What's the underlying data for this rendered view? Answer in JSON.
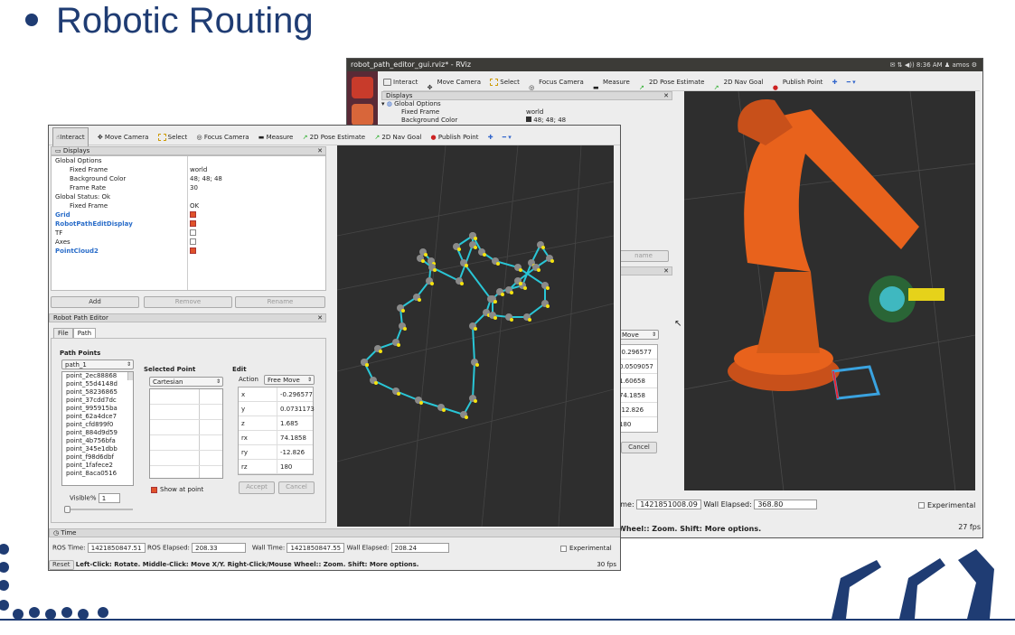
{
  "slide": {
    "title": "Robotic Routing"
  },
  "back_window": {
    "title": "robot_path_editor_gui.rviz* - RViz",
    "clock": "8:36 AM",
    "user": "amos",
    "toolbar": [
      "Interact",
      "Move Camera",
      "Select",
      "Focus Camera",
      "Measure",
      "2D Pose Estimate",
      "2D Nav Goal",
      "Publish Point"
    ],
    "displays_title": "Displays",
    "tree": [
      {
        "k": "Global Options",
        "v": ""
      },
      {
        "k": "Fixed Frame",
        "v": "world"
      },
      {
        "k": "Background Color",
        "v": "48; 48; 48"
      }
    ],
    "rename_partial": "name",
    "move_partial": "Move",
    "values": [
      "-0.296577",
      "0.0509057",
      "1.60658",
      "74.1858",
      "-12.826",
      "180"
    ],
    "cancel": "Cancel",
    "time_partial": "ime:",
    "ros_time": "1421851008.09",
    "wall_elapsed_label": "Wall Elapsed:",
    "wall_elapsed": "368.80",
    "experimental": "Experimental",
    "status": "Wheel:: Zoom. Shift: More options.",
    "status_prefix": "Wheel:",
    "fps": "27 fps"
  },
  "front_window": {
    "toolbar": [
      "Interact",
      "Move Camera",
      "Select",
      "Focus Camera",
      "Measure",
      "2D Pose Estimate",
      "2D Nav Goal",
      "Publish Point"
    ],
    "displays_title": "Displays",
    "tree": [
      {
        "k": "Global Options",
        "v": "",
        "indent": 0,
        "blue": false
      },
      {
        "k": "Fixed Frame",
        "v": "world",
        "indent": 1,
        "blue": false
      },
      {
        "k": "Background Color",
        "v": "48; 48; 48",
        "indent": 1,
        "blue": false
      },
      {
        "k": "Frame Rate",
        "v": "30",
        "indent": 1,
        "blue": false
      },
      {
        "k": "Global Status: Ok",
        "v": "",
        "indent": 0,
        "blue": false
      },
      {
        "k": "Fixed Frame",
        "v": "OK",
        "indent": 1,
        "blue": false
      },
      {
        "k": "Grid",
        "v": "",
        "indent": 0,
        "blue": true
      },
      {
        "k": "RobotPathEditDisplay",
        "v": "",
        "indent": 0,
        "blue": true
      },
      {
        "k": "TF",
        "v": "",
        "indent": 0,
        "blue": false
      },
      {
        "k": "Axes",
        "v": "",
        "indent": 0,
        "blue": false
      },
      {
        "k": "PointCloud2",
        "v": "",
        "indent": 0,
        "blue": true
      }
    ],
    "buttons": {
      "add": "Add",
      "remove": "Remove",
      "rename": "Rename"
    },
    "editor_title": "Robot Path Editor",
    "tabs": [
      "File",
      "Path"
    ],
    "path_points_label": "Path Points",
    "path_combo": "path_1",
    "points": [
      "point_2ec88868",
      "point_55d4148d",
      "point_58236865",
      "point_37cdd7dc",
      "point_995915ba",
      "point_62a4dce7",
      "point_cfd899f0",
      "point_884d9d59",
      "point_4b756bfa",
      "point_345e1dbb",
      "point_f98d6dbf",
      "point_1fafece2",
      "point_8aca0516"
    ],
    "visible_label": "Visible%",
    "visible_value": "1",
    "selected_point_label": "Selected Point",
    "frame_combo": "Cartesian",
    "show_at_point": "Show at point",
    "edit_label": "Edit",
    "action_label": "Action",
    "action_value": "Free Move",
    "edit_rows": [
      {
        "k": "x",
        "v": "-0.296577"
      },
      {
        "k": "y",
        "v": "0.0731173"
      },
      {
        "k": "z",
        "v": "1.685"
      },
      {
        "k": "rx",
        "v": "74.1858"
      },
      {
        "k": "ry",
        "v": "-12.826"
      },
      {
        "k": "rz",
        "v": "180"
      }
    ],
    "accept": "Accept",
    "cancel": "Cancel",
    "time_title": "Time",
    "ros_time_label": "ROS Time:",
    "ros_time": "1421850847.51",
    "ros_elapsed_label": "ROS Elapsed:",
    "ros_elapsed": "208.33",
    "wall_time_label": "Wall Time:",
    "wall_time": "1421850847.55",
    "wall_elapsed_label": "Wall Elapsed:",
    "wall_elapsed": "208.24",
    "experimental": "Experimental",
    "reset": "Reset",
    "status": "Left-Click: Rotate. Middle-Click: Move X/Y. Right-Click/Mouse Wheel:: Zoom. Shift: More options.",
    "fps": "30 fps"
  },
  "colors": {
    "brand": "#1f3c73",
    "viewport": "#2e2e2e",
    "robot": "#e8621c",
    "path": "#29c6d6",
    "point": "#f5e30f"
  }
}
